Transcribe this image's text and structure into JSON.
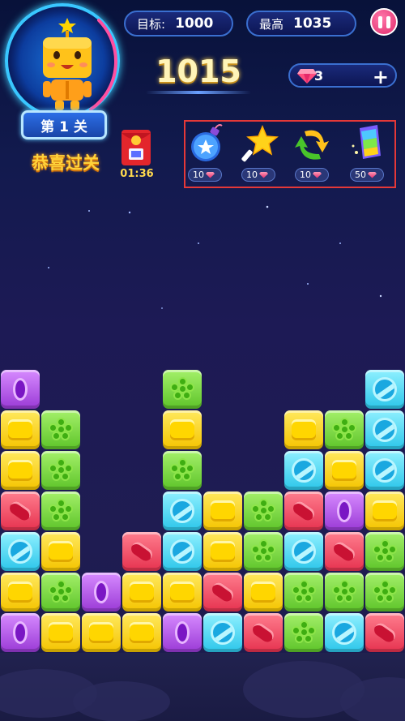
{
  "header": {
    "goal_label": "目标:",
    "goal_value": "1000",
    "best_label": "最高",
    "best_value": "1035",
    "score": "1015",
    "gems": "3",
    "add_label": "+"
  },
  "level": {
    "label": "第 1 关",
    "congrats": "恭喜过关"
  },
  "red_packet": {
    "timer": "01:36"
  },
  "tools": [
    {
      "name": "bomb",
      "icon": "bomb-icon",
      "cost": "10"
    },
    {
      "name": "magic-wand",
      "icon": "star-wand-icon",
      "cost": "10"
    },
    {
      "name": "swap",
      "icon": "swap-arrows-icon",
      "cost": "10"
    },
    {
      "name": "rainbow",
      "icon": "rainbow-card-icon",
      "cost": "50"
    }
  ],
  "colors": {
    "yellow": "#f5c400",
    "green": "#5ec42a",
    "blue": "#2cc6ea",
    "red": "#e6324f",
    "purple": "#9a3ad6",
    "accent": "#ffd23a"
  },
  "board": {
    "columns": 10,
    "rows": [
      [
        "purple",
        "",
        "",
        "",
        "green",
        "",
        "",
        "",
        "",
        "blue"
      ],
      [
        "yellow",
        "green",
        "",
        "",
        "yellow",
        "",
        "",
        "yellow",
        "green",
        "blue"
      ],
      [
        "yellow",
        "green",
        "",
        "",
        "green",
        "",
        "",
        "blue",
        "yellow",
        "blue"
      ],
      [
        "red",
        "green",
        "",
        "",
        "blue",
        "yellow",
        "green",
        "red",
        "purple",
        "yellow"
      ],
      [
        "blue",
        "yellow",
        "",
        "red",
        "blue",
        "yellow",
        "green",
        "blue",
        "red",
        "green"
      ],
      [
        "yellow",
        "green",
        "purple",
        "yellow",
        "yellow",
        "red",
        "yellow",
        "green",
        "green",
        "green"
      ],
      [
        "purple",
        "yellow",
        "yellow",
        "yellow",
        "purple",
        "blue",
        "red",
        "green",
        "blue",
        "red"
      ]
    ]
  }
}
